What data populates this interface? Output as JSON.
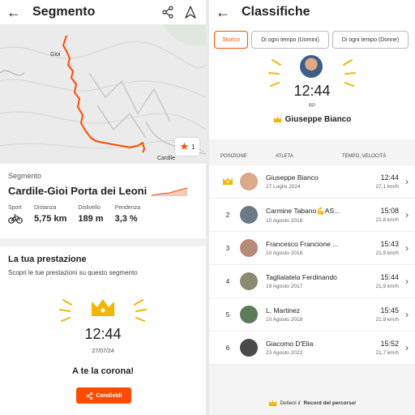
{
  "left": {
    "title": "Segmento",
    "map": {
      "town_gioi": "Gioi",
      "town_cardile": "Cardile",
      "star_count": "1"
    },
    "segment": {
      "section_label": "Segmento",
      "name": "Cardile-Gioi Porta dei Leoni",
      "stats": [
        {
          "label": "Sport",
          "value": "",
          "icon": "bike-icon"
        },
        {
          "label": "Distanza",
          "value": "5,75 km"
        },
        {
          "label": "Dislivello",
          "value": "189 m"
        },
        {
          "label": "Pendenza",
          "value": "3,3 %"
        }
      ]
    },
    "performance": {
      "heading": "La tua prestazione",
      "subtitle": "Scopri le tue prestazioni su questo segmento",
      "time": "12:44",
      "date": "27/07/24",
      "crown_message": "A te la corona!",
      "share_label": "Condividi"
    }
  },
  "right": {
    "title": "Classifiche",
    "filters": [
      "Storico",
      "Di ogni tempo (Uomini)",
      "Di ogni tempo (Donne)"
    ],
    "record": {
      "time": "12:44",
      "rp_label": "RP",
      "name": "Giuseppe Bianco"
    },
    "table_headers": {
      "position": "POSIZIONE",
      "athlete": "ATLETA",
      "time_speed": "TEMPO, VELOCITÀ"
    },
    "rows": [
      {
        "rank": "",
        "name": "Giuseppe Bianco",
        "date": "27 Luglio 2024",
        "time": "12:44",
        "speed": "27,1 km/h",
        "avatar_color": "#d9a98a"
      },
      {
        "rank": "2",
        "name": "Carmine Tabano💪AS...",
        "date": "10 Agosto 2018",
        "time": "15:08",
        "speed": "22,8 km/h",
        "avatar_color": "#6c7a86"
      },
      {
        "rank": "3",
        "name": "Francesco Francione ...",
        "date": "10 Agosto 2018",
        "time": "15:43",
        "speed": "21,9 km/h",
        "avatar_color": "#b88a7a"
      },
      {
        "rank": "4",
        "name": "Taglialatela Ferdinando",
        "date": "19 Agosto 2017",
        "time": "15:44",
        "speed": "21,9 km/h",
        "avatar_color": "#8a8a72"
      },
      {
        "rank": "5",
        "name": "L. Martinez",
        "date": "10 Agosto 2018",
        "time": "15:45",
        "speed": "21,9 km/h",
        "avatar_color": "#5d7a5a"
      },
      {
        "rank": "6",
        "name": "Giacomo D'Elia",
        "date": "23 Agosto 2022",
        "time": "15:52",
        "speed": "21,7 km/h",
        "avatar_color": "#4a4a4a"
      }
    ],
    "footer_pre": "Detieni il",
    "footer_bold": "Record del percorso",
    "footer_post": "!"
  },
  "colors": {
    "accent": "#fc4c02",
    "crown": "#f2b705"
  }
}
